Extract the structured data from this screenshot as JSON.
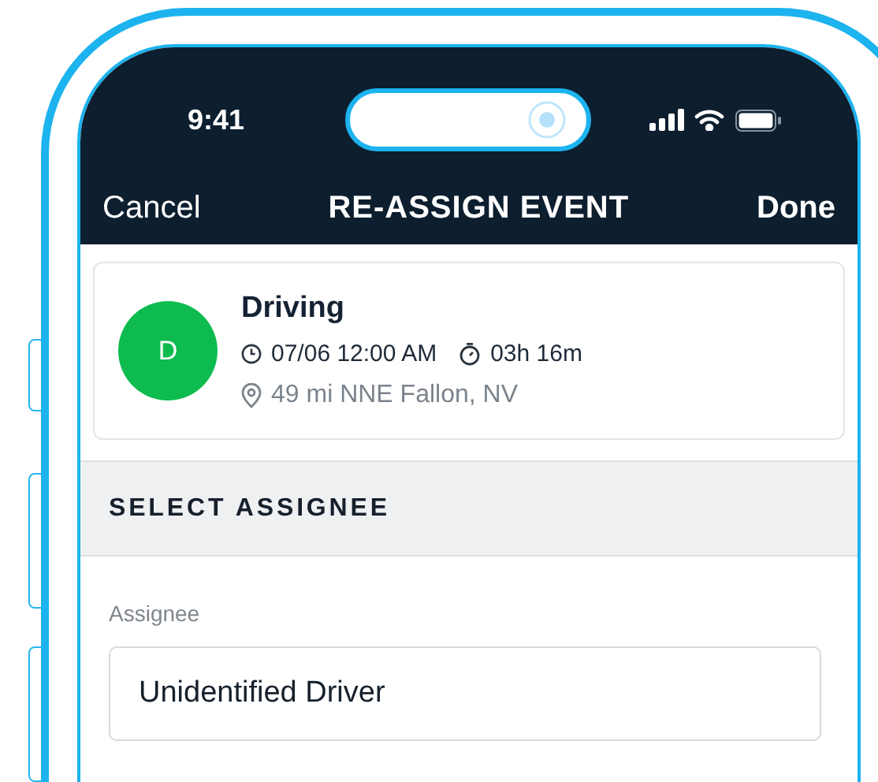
{
  "status_bar": {
    "time": "9:41"
  },
  "nav": {
    "cancel": "Cancel",
    "title": "RE-ASSIGN EVENT",
    "done": "Done"
  },
  "event": {
    "avatar": "D",
    "status": "Driving",
    "start": "07/06 12:00 AM",
    "duration": "03h 16m",
    "location": "49 mi NNE Fallon, NV"
  },
  "section": {
    "title": "SELECT ASSIGNEE"
  },
  "assignee": {
    "label": "Assignee",
    "value": "Unidentified Driver"
  }
}
